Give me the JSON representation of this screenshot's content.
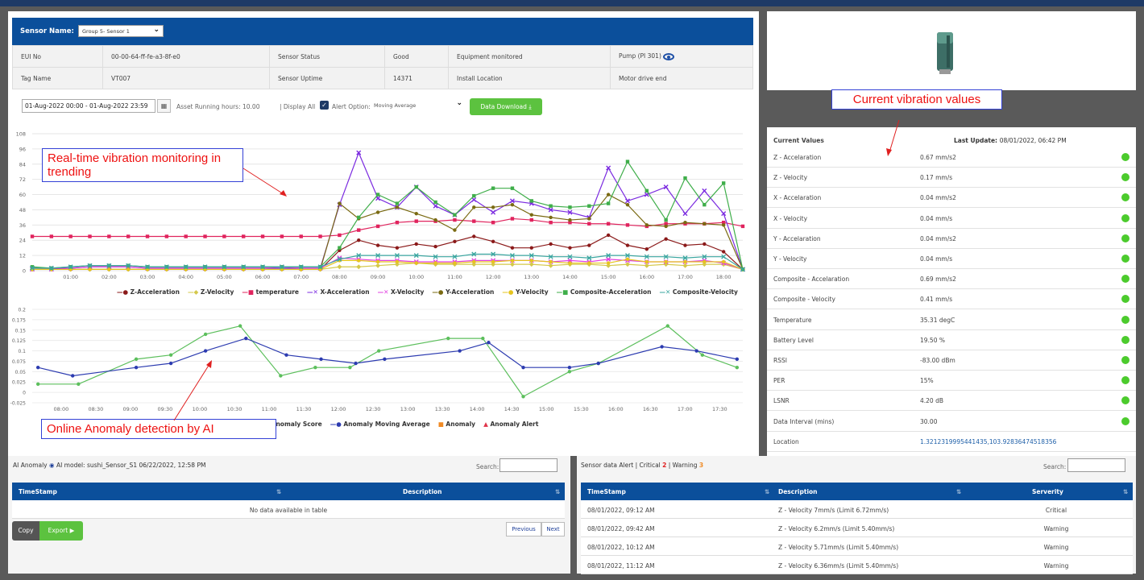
{
  "sensor": {
    "name_label": "Sensor Name:",
    "name_value": "Group 5- Sensor 1",
    "info_rows": [
      [
        "EUI No",
        "00-00-64-ff-fe-a3-8f-e0",
        "Sensor Status",
        "Good",
        "Equipment monitored",
        "Pump (PI 301)"
      ],
      [
        "Tag Name",
        "VT007",
        "Sensor Uptime",
        "14371",
        "Install Location",
        "Motor drive end"
      ]
    ]
  },
  "controls": {
    "date_range": "01-Aug-2022 00:00 - 01-Aug-2022 23:59",
    "asset_hours": "Asset Running hours: 10.00",
    "display_all": "| Display All",
    "alert_option_label": "Alert Option:",
    "alert_option_value": "Moving Average",
    "download_label": "Data Download"
  },
  "annotations": {
    "trend": "Real-time vibration monitoring in trending",
    "anomaly": "Online Anomaly detection by AI",
    "current": "Current vibration values"
  },
  "chart_data": [
    {
      "type": "line",
      "x": [
        "00:00",
        "00:30",
        "01:00",
        "01:30",
        "02:00",
        "02:30",
        "03:00",
        "03:30",
        "04:00",
        "04:30",
        "05:00",
        "05:30",
        "06:00",
        "06:30",
        "07:00",
        "07:30",
        "08:00",
        "08:30",
        "09:00",
        "09:30",
        "10:00",
        "10:30",
        "11:00",
        "11:30",
        "12:00",
        "12:30",
        "13:00",
        "13:30",
        "14:00",
        "14:30",
        "15:00",
        "15:30",
        "16:00",
        "16:30",
        "17:00",
        "17:30",
        "18:00",
        "18:30"
      ],
      "xticks": [
        "01:00",
        "02:00",
        "03:00",
        "04:00",
        "05:00",
        "06:00",
        "07:00",
        "08:00",
        "09:00",
        "10:00",
        "11:00",
        "12:00",
        "13:00",
        "14:00",
        "15:00",
        "16:00",
        "17:00",
        "18:00"
      ],
      "yticks": [
        0,
        12,
        24,
        36,
        48,
        60,
        72,
        84,
        96,
        108
      ],
      "ylim": [
        0,
        108
      ],
      "series": [
        {
          "name": "Z-Acceleration",
          "color": "#8b1a1a",
          "marker": "circle",
          "values": [
            1,
            1,
            1,
            1,
            1,
            1,
            1,
            1,
            1,
            1,
            1,
            1,
            1,
            1,
            1,
            1,
            16,
            24,
            20,
            18,
            21,
            19,
            23,
            27,
            23,
            18,
            18,
            21,
            18,
            20,
            28,
            20,
            17,
            25,
            20,
            21,
            15,
            1
          ]
        },
        {
          "name": "Z-Velocity",
          "color": "#d4c84a",
          "marker": "diamond",
          "values": [
            1,
            1,
            1,
            1,
            1,
            1,
            1,
            1,
            1,
            1,
            1,
            1,
            1,
            1,
            1,
            1,
            3,
            3,
            4,
            5,
            6,
            5,
            5,
            5,
            5,
            5,
            5,
            4,
            5,
            5,
            4,
            5,
            4,
            5,
            4,
            5,
            5,
            1
          ]
        },
        {
          "name": "temperature",
          "color": "#e0245e",
          "marker": "square",
          "values": [
            27,
            27,
            27,
            27,
            27,
            27,
            27,
            27,
            27,
            27,
            27,
            27,
            27,
            27,
            27,
            27,
            28,
            32,
            35,
            38,
            39,
            39,
            40,
            39,
            38,
            41,
            40,
            38,
            38,
            37,
            37,
            36,
            35,
            37,
            37,
            37,
            38,
            35
          ]
        },
        {
          "name": "X-Acceleration",
          "color": "#7b2be0",
          "marker": "cross",
          "values": [
            2,
            2,
            2,
            3,
            3,
            3,
            2,
            2,
            2,
            2,
            2,
            2,
            2,
            2,
            2,
            2,
            52,
            93,
            57,
            50,
            66,
            51,
            44,
            56,
            46,
            55,
            53,
            48,
            46,
            42,
            81,
            55,
            60,
            66,
            45,
            63,
            45,
            1
          ]
        },
        {
          "name": "X-Velocity",
          "color": "#e040e0",
          "marker": "cross",
          "values": [
            1,
            1,
            2,
            3,
            3,
            3,
            2,
            2,
            2,
            2,
            2,
            2,
            2,
            3,
            2,
            2,
            10,
            9,
            8,
            8,
            7,
            7,
            7,
            8,
            8,
            8,
            8,
            7,
            8,
            7,
            9,
            8,
            7,
            7,
            7,
            8,
            6,
            1
          ]
        },
        {
          "name": "Y-Acceleration",
          "color": "#7a6a12",
          "marker": "circle",
          "values": [
            1,
            1,
            1,
            1,
            1,
            1,
            1,
            1,
            1,
            1,
            1,
            1,
            1,
            1,
            1,
            1,
            53,
            41,
            46,
            50,
            45,
            40,
            32,
            50,
            50,
            52,
            44,
            42,
            40,
            41,
            60,
            52,
            36,
            35,
            38,
            37,
            36,
            1
          ]
        },
        {
          "name": "Y-Velocity",
          "color": "#e6c41e",
          "marker": "circle",
          "values": [
            1,
            1,
            1,
            1,
            1,
            1,
            1,
            1,
            1,
            1,
            1,
            1,
            1,
            1,
            1,
            1,
            8,
            8,
            7,
            7,
            6,
            6,
            6,
            7,
            7,
            8,
            8,
            7,
            6,
            6,
            6,
            9,
            7,
            7,
            7,
            7,
            7,
            1
          ]
        },
        {
          "name": "Composite-Acceleration",
          "color": "#3fae4a",
          "marker": "square",
          "values": [
            3,
            2,
            3,
            4,
            4,
            4,
            3,
            3,
            3,
            3,
            3,
            3,
            3,
            3,
            3,
            3,
            18,
            42,
            60,
            53,
            66,
            54,
            44,
            59,
            65,
            65,
            55,
            51,
            50,
            51,
            53,
            86,
            63,
            40,
            73,
            52,
            69,
            1
          ]
        },
        {
          "name": "Composite-Velocity",
          "color": "#3aa6a0",
          "marker": "cross",
          "values": [
            2,
            2,
            3,
            4,
            4,
            4,
            3,
            3,
            3,
            3,
            3,
            3,
            3,
            3,
            3,
            3,
            9,
            12,
            12,
            12,
            12,
            11,
            11,
            13,
            13,
            12,
            12,
            11,
            11,
            10,
            12,
            12,
            11,
            11,
            10,
            11,
            11,
            1
          ]
        }
      ]
    },
    {
      "type": "line",
      "x": [
        "07:40",
        "07:55",
        "08:15",
        "08:35",
        "08:50",
        "09:05",
        "09:25",
        "09:40",
        "10:00",
        "10:25",
        "10:40",
        "10:55",
        "11:10",
        "11:25",
        "11:45",
        "12:15",
        "12:40",
        "13:05",
        "13:20",
        "13:45",
        "14:05",
        "14:35",
        "15:00",
        "15:30",
        "16:00",
        "16:25",
        "16:50",
        "17:05",
        "17:25",
        "17:40"
      ],
      "xticks": [
        "08:00",
        "08:30",
        "09:00",
        "09:30",
        "10:00",
        "10:30",
        "11:00",
        "11:30",
        "12:00",
        "12:30",
        "13:00",
        "13:30",
        "14:00",
        "14:30",
        "15:00",
        "15:30",
        "16:00",
        "16:30",
        "17:00",
        "17:30"
      ],
      "yticks": [
        -0.025,
        0,
        0.025,
        0.05,
        0.075,
        0.1,
        0.125,
        0.15,
        0.175,
        0.2
      ],
      "ylim": [
        -0.025,
        0.2
      ],
      "series": [
        {
          "name": "Anomaly Score",
          "color": "#5cbf5c",
          "marker": "circle",
          "points": [
            [
              "07:40",
              0.02
            ],
            [
              "08:15",
              0.02
            ],
            [
              "09:05",
              0.08
            ],
            [
              "09:35",
              0.09
            ],
            [
              "10:05",
              0.14
            ],
            [
              "10:35",
              0.16
            ],
            [
              "11:10",
              0.04
            ],
            [
              "11:40",
              0.06
            ],
            [
              "12:10",
              0.06
            ],
            [
              "12:35",
              0.1
            ],
            [
              "13:35",
              0.13
            ],
            [
              "14:05",
              0.13
            ],
            [
              "14:40",
              -0.01
            ],
            [
              "15:20",
              0.05
            ],
            [
              "15:45",
              0.07
            ],
            [
              "16:45",
              0.16
            ],
            [
              "17:15",
              0.09
            ],
            [
              "17:45",
              0.06
            ]
          ]
        },
        {
          "name": "Anomaly Moving Average",
          "color": "#2c3bb0",
          "marker": "circle",
          "points": [
            [
              "07:40",
              0.06
            ],
            [
              "08:10",
              0.04
            ],
            [
              "09:05",
              0.06
            ],
            [
              "09:35",
              0.07
            ],
            [
              "10:05",
              0.1
            ],
            [
              "10:40",
              0.13
            ],
            [
              "11:15",
              0.09
            ],
            [
              "11:45",
              0.08
            ],
            [
              "12:15",
              0.07
            ],
            [
              "12:40",
              0.08
            ],
            [
              "13:45",
              0.1
            ],
            [
              "14:10",
              0.12
            ],
            [
              "14:40",
              0.06
            ],
            [
              "15:20",
              0.06
            ],
            [
              "15:45",
              0.07
            ],
            [
              "16:40",
              0.11
            ],
            [
              "17:10",
              0.1
            ],
            [
              "17:45",
              0.08
            ]
          ]
        },
        {
          "name": "Anomaly",
          "color": "#f08a24",
          "marker": "square",
          "points": []
        },
        {
          "name": "Anomaly Alert",
          "color": "#e0344a",
          "marker": "triangle",
          "points": []
        }
      ]
    }
  ],
  "current_values": {
    "title": "Current Values",
    "last_update_label": "Last Update:",
    "last_update_value": "08/01/2022, 06:42 PM",
    "rows": [
      {
        "name": "Z - Accelaration",
        "value": "0.67 mm/s2",
        "dot": true
      },
      {
        "name": "Z - Velocity",
        "value": "0.17 mm/s",
        "dot": true
      },
      {
        "name": "X - Accelaration",
        "value": "0.04 mm/s2",
        "dot": true
      },
      {
        "name": "X - Velocity",
        "value": "0.04 mm/s",
        "dot": true
      },
      {
        "name": "Y - Accelaration",
        "value": "0.04 mm/s2",
        "dot": true
      },
      {
        "name": "Y - Velocity",
        "value": "0.04 mm/s",
        "dot": true
      },
      {
        "name": "Composite - Accelaration",
        "value": "0.69 mm/s2",
        "dot": true
      },
      {
        "name": "Composite - Velocity",
        "value": "0.41 mm/s",
        "dot": true
      },
      {
        "name": "Temperature",
        "value": "35.31 degC",
        "dot": true
      },
      {
        "name": "Battery Level",
        "value": "19.50 %",
        "dot": true
      },
      {
        "name": "RSSI",
        "value": "-83.00 dBm",
        "dot": true
      },
      {
        "name": "PER",
        "value": "15%",
        "dot": true
      },
      {
        "name": "LSNR",
        "value": "4.20 dB",
        "dot": true
      },
      {
        "name": "Data Interval (mins)",
        "value": "30.00",
        "dot": true
      },
      {
        "name": "Location",
        "value": "1.3212319995441435,103.92836474518356",
        "dot": false
      }
    ]
  },
  "ai_anomaly": {
    "title_prefix": "AI Anomaly",
    "title_rest": "AI model: sushi_Sensor_S1 06/22/2022, 12:58 PM",
    "search_label": "Search:",
    "columns": [
      "TimeStamp",
      "Description"
    ],
    "empty_text": "No data available in table",
    "copy_label": "Copy",
    "export_label": "Export",
    "previous_label": "Previous",
    "next_label": "Next"
  },
  "alerts": {
    "title": "Sensor data Alert | Critical",
    "critical_count": "2",
    "warning_label": "| Warning",
    "warning_count": "3",
    "search_label": "Search:",
    "columns": [
      "TimeStamp",
      "Description",
      "Serverity"
    ],
    "rows": [
      [
        "08/01/2022, 09:12 AM",
        "Z - Velocity 7mm/s (Limit 6.72mm/s)",
        "Critical"
      ],
      [
        "08/01/2022, 09:42 AM",
        "Z - Velocity 6.2mm/s (Limit 5.40mm/s)",
        "Warning"
      ],
      [
        "08/01/2022, 10:12 AM",
        "Z - Velocity 5.71mm/s (Limit 5.40mm/s)",
        "Warning"
      ],
      [
        "08/01/2022, 11:12 AM",
        "Z - Velocity 6.36mm/s (Limit 5.40mm/s)",
        "Warning"
      ]
    ]
  }
}
